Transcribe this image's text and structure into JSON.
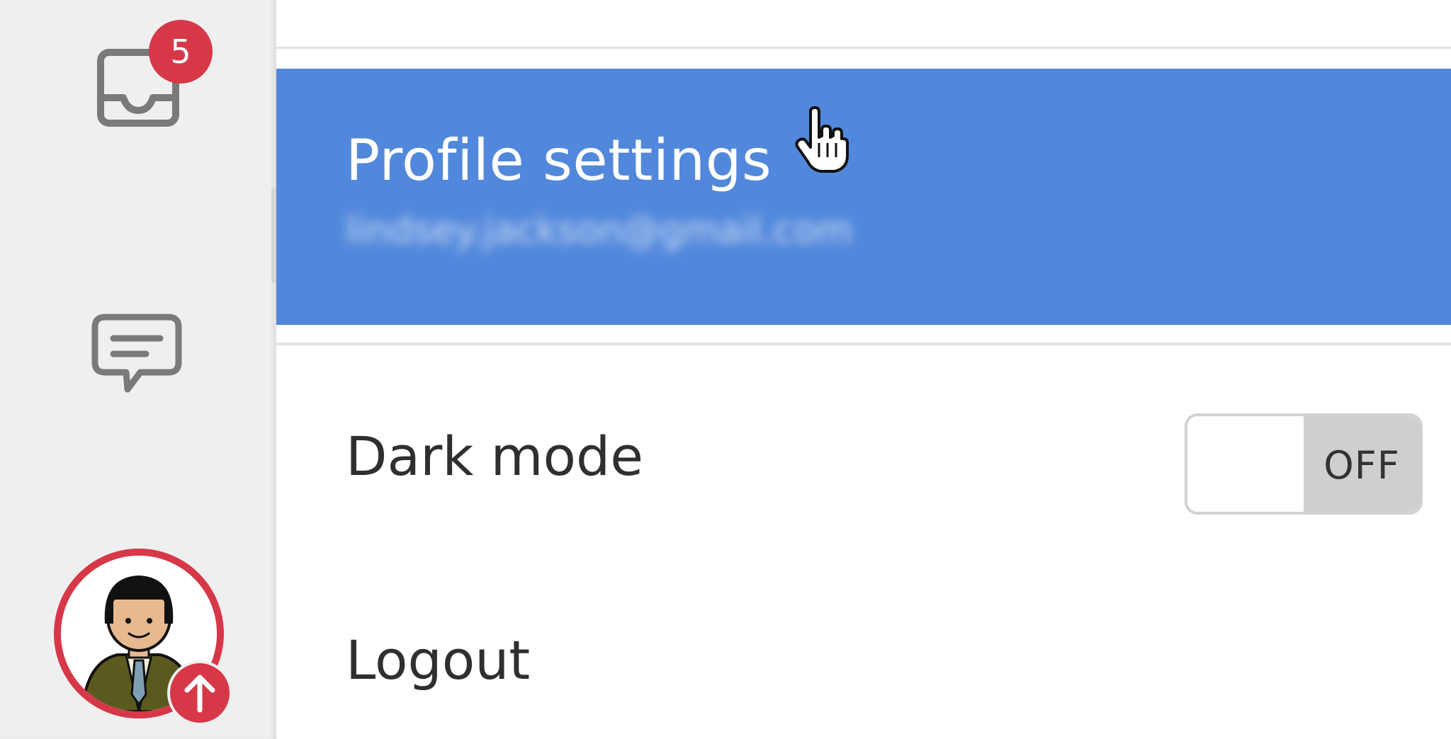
{
  "rail": {
    "inbox": {
      "icon": "inbox-icon",
      "badge_count": "5"
    },
    "chat": {
      "icon": "chat-icon"
    },
    "avatar": {
      "upload_icon": "arrow-up-icon"
    }
  },
  "menu": {
    "profile": {
      "title": "Profile settings",
      "email": "lindsey.jackson@gmail.com"
    },
    "dark_mode": {
      "label": "Dark mode",
      "toggle_state": "OFF"
    },
    "logout": {
      "label": "Logout"
    }
  },
  "colors": {
    "accent_blue": "#5288db",
    "badge_red": "#d63848",
    "rail_bg": "#efefef"
  }
}
